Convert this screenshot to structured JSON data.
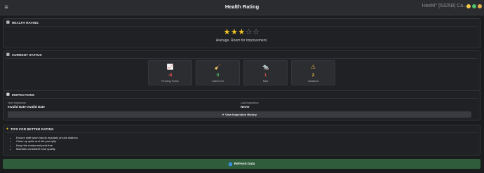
{
  "window": {
    "title": "Health Rating",
    "label": "HeeM° [6325B] Ca...",
    "controls": [
      {
        "name": "minimize",
        "color": "#f2c94c"
      },
      {
        "name": "maximize",
        "color": "#4fc26b"
      },
      {
        "name": "close",
        "color": "#e8b04a"
      }
    ]
  },
  "health": {
    "header": "HEALTH RATING",
    "rating": 3,
    "max": 5,
    "description": "Average. Room for improvement."
  },
  "status": {
    "header": "CURRENT STATUS",
    "cards": [
      {
        "icon": "trend-chart-icon",
        "glyph": "📈",
        "value": "-8",
        "label": "Pending Points",
        "color": "#e05252"
      },
      {
        "icon": "broom-icon",
        "glyph": "🧹",
        "value": "0",
        "label": "Active Dirt",
        "color": "#55c46d"
      },
      {
        "icon": "rat-icon",
        "glyph": "🐀",
        "value": "1",
        "label": "Rats",
        "color": "#e05252"
      },
      {
        "icon": "warning-icon",
        "glyph": "⚠",
        "value": "2",
        "label": "Violations",
        "color": "#e5b84a"
      }
    ]
  },
  "inspections": {
    "header": "INSPECTIONS",
    "next_label": "Next Inspection",
    "next_value": "Invalid Date Invalid Date",
    "last_label": "Last Inspection",
    "last_value": "Never",
    "history_button": "View Inspection History"
  },
  "tips": {
    "header": "TIPS FOR BETTER RATING",
    "items": [
      "Ensure staff wash hands regularly at sink stations",
      "Clean up spills and dirt promptly",
      "Keep the restaurant pest-free",
      "Maintain consistent food quality"
    ]
  },
  "refresh_button": "Refresh Data"
}
